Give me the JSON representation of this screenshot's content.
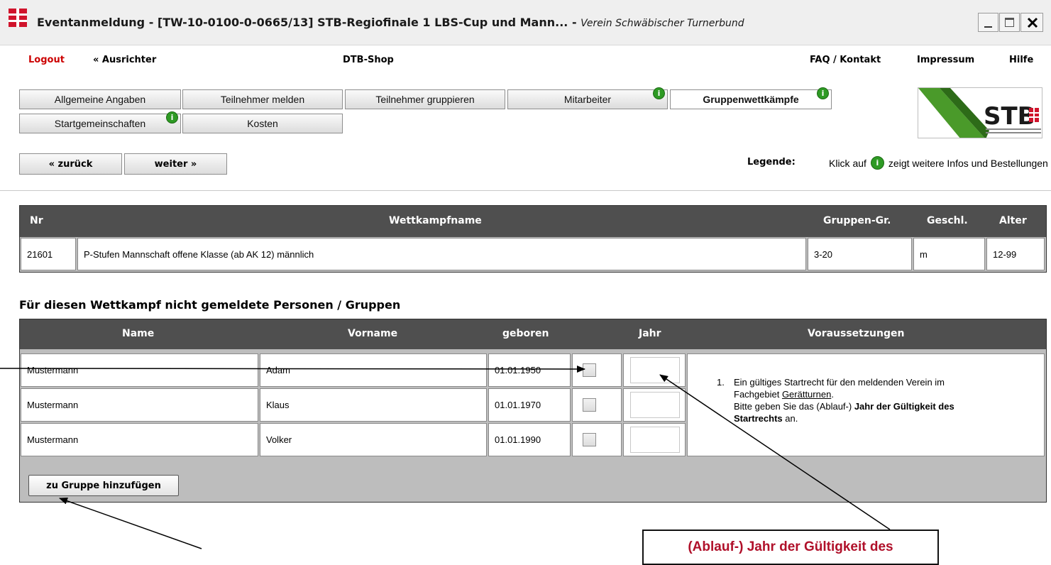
{
  "window": {
    "title_main": "Eventanmeldung  -  [TW-10-0100-0-0665/13] STB-Regiofinale 1 LBS-Cup und Mann...",
    "title_sep": "  -  ",
    "title_club": "Verein Schwäbischer Turnerbund",
    "buttons": {
      "minimize": "_",
      "maximize": "□",
      "close": "X"
    }
  },
  "nav": {
    "logout": "Logout",
    "ausrichter": "« Ausrichter",
    "shop": "DTB-Shop",
    "faq": "FAQ / Kontakt",
    "impressum": "Impressum",
    "hilfe": "Hilfe"
  },
  "tabs": [
    {
      "label": "Allgemeine Angaben"
    },
    {
      "label": "Teilnehmer melden"
    },
    {
      "label": "Teilnehmer gruppieren"
    },
    {
      "label": "Mitarbeiter"
    },
    {
      "label": "Gruppenwettkämpfe"
    },
    {
      "label": "Startgemeinschaften"
    },
    {
      "label": "Kosten"
    }
  ],
  "info_glyph": "i",
  "buttons": {
    "back": "« zurück",
    "next": "weiter »",
    "add_group": "zu Gruppe hinzufügen"
  },
  "legend": {
    "label": "Legende:",
    "text_before": "Klick auf",
    "text_after": "zeigt weitere Infos und Bestellungen an."
  },
  "logo": {
    "text": "STB"
  },
  "competition_table": {
    "headers": [
      "Nr",
      "Wettkampfname",
      "Gruppen-Gr.",
      "Geschl.",
      "Alter"
    ],
    "row": [
      "21601",
      "P-Stufen Mannschaft offene Klasse (ab AK 12) männlich",
      "3-20",
      "m",
      "12-99"
    ]
  },
  "section_title": "Für diesen Wettkampf nicht gemeldete Personen / Gruppen",
  "persons_table": {
    "headers": [
      "Name",
      "Vorname",
      "geboren",
      "Jahr",
      "Voraussetzungen"
    ],
    "rows": [
      {
        "name": "Mustermann",
        "vorname": "Adam",
        "geboren": "01.01.1950"
      },
      {
        "name": "Mustermann",
        "vorname": "Klaus",
        "geboren": "01.01.1970"
      },
      {
        "name": "Mustermann",
        "vorname": "Volker",
        "geboren": "01.01.1990"
      }
    ],
    "requirement": {
      "num": "1.",
      "line1": "Ein gültiges Startrecht für den meldenden Verein im",
      "line2a": "Fachgebiet ",
      "line2_link": "Gerätturnen",
      "line2b": ".",
      "line3a": "Bitte geben Sie das (Ablauf-) ",
      "line3_bold": "Jahr der Gültigkeit des",
      "line4_bold": "Startrechts",
      "line4b": " an."
    }
  },
  "callout": {
    "text": "(Ablauf-) Jahr der Gültigkeit des"
  },
  "colors": {
    "header_bg": "#4f4f4f",
    "logout": "#cc0000",
    "info_green": "#2e9a24",
    "callout_text": "#b0102a"
  }
}
